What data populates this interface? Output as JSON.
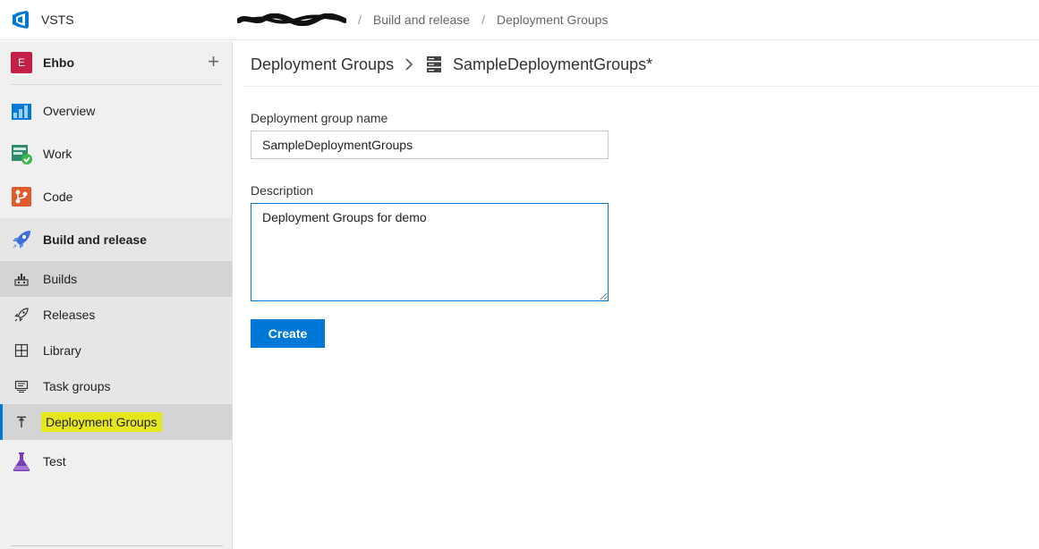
{
  "app": {
    "name": "VSTS"
  },
  "topbar": {
    "breadcrumb": [
      {
        "label": "Build and release"
      },
      {
        "label": "Deployment Groups"
      }
    ],
    "separator": "/"
  },
  "sidebar": {
    "project": {
      "initial": "E",
      "name": "Ehbo",
      "add_label": "+"
    },
    "items": [
      {
        "label": "Overview",
        "icon": "overview-icon"
      },
      {
        "label": "Work",
        "icon": "work-icon"
      },
      {
        "label": "Code",
        "icon": "code-icon"
      },
      {
        "label": "Build and release",
        "icon": "rocket-icon"
      },
      {
        "label": "Builds",
        "icon": "builds-icon"
      },
      {
        "label": "Releases",
        "icon": "releases-icon"
      },
      {
        "label": "Library",
        "icon": "library-icon"
      },
      {
        "label": "Task groups",
        "icon": "task-groups-icon"
      },
      {
        "label": "Deployment Groups",
        "icon": "deployment-groups-icon"
      },
      {
        "label": "Test",
        "icon": "test-flask-icon"
      }
    ]
  },
  "main": {
    "header": {
      "parent_link": "Deployment Groups",
      "title": "SampleDeploymentGroups*"
    },
    "form": {
      "name_label": "Deployment group name",
      "name_value": "SampleDeploymentGroups",
      "description_label": "Description",
      "description_value": "Deployment Groups for demo",
      "create_label": "Create"
    }
  },
  "colors": {
    "accent": "#0078d7",
    "avatar": "#c4204a",
    "highlight": "#e6e61e"
  }
}
